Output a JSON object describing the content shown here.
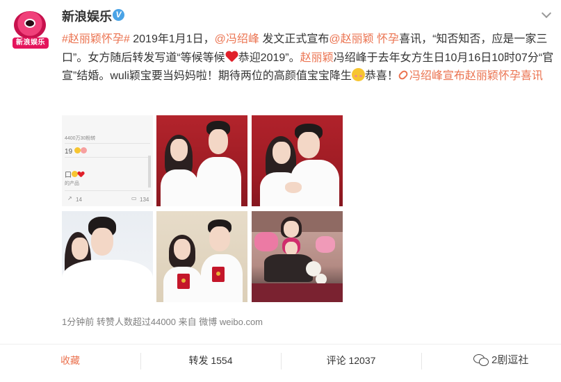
{
  "account": {
    "name": "新浪娱乐",
    "avatar_text": "新浪娱乐",
    "verified_mark": "V"
  },
  "post": {
    "t1": "#赵丽颖怀孕#",
    "t2": " 2019年1月1日，",
    "t3": "@冯绍峰",
    "t4": " 发文正式宣布",
    "t5": "@赵丽颖",
    "t6": " 怀孕",
    "t7": "喜讯，“知否知否，应是一家三口”。女方随后转发写道“等候等候",
    "t8": "恭迎2019”。",
    "t9": "赵丽颖",
    "t10": "冯绍峰于去年女方生日10月16日10时07分“官宣”结婚。wuli颖宝要当妈妈啦！期待两位的高颜值宝宝降生",
    "t11": "恭喜！",
    "t12": "冯绍峰宣布赵丽颖怀孕",
    "t13": "喜讯"
  },
  "photo1": {
    "line1": "4400万30粉转",
    "line2": "19",
    "line3": "口",
    "line4": "的产品",
    "repost_count": "14",
    "comment_count": "134"
  },
  "meta": {
    "time": "1分钟前",
    "reposts_note": "转赞人数超过44000",
    "source": "来自 微博 weibo.com"
  },
  "actions": {
    "favorite": "收藏",
    "repost": "转发 1554",
    "comment": "评论 12037",
    "like": "2"
  },
  "watermark": {
    "text": "2剧逗社"
  }
}
